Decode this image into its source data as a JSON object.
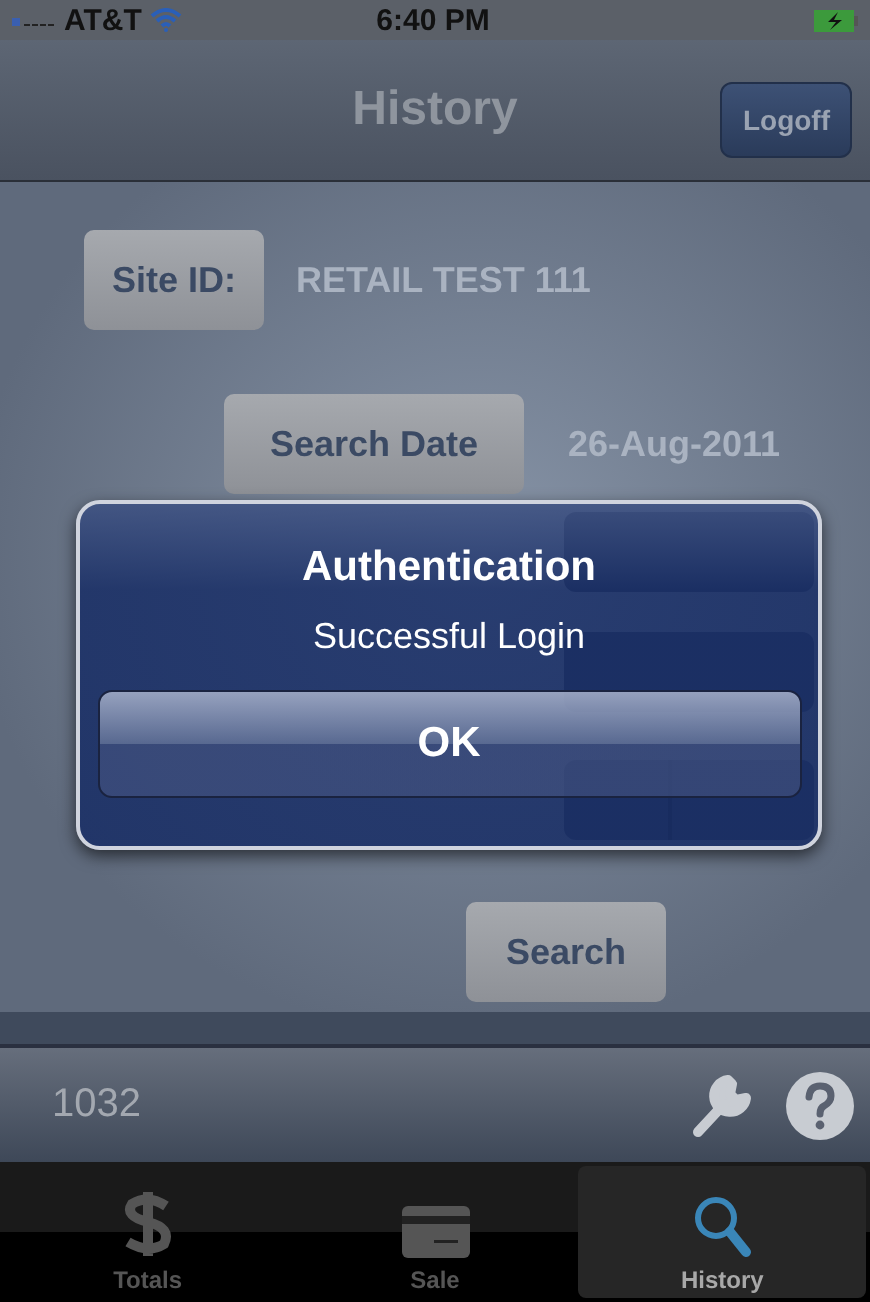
{
  "status_bar": {
    "carrier": "AT&T",
    "time": "6:40 PM"
  },
  "nav_bar": {
    "title": "History",
    "button": "Logoff"
  },
  "form": {
    "site_id_button": "Site ID:",
    "site_id_value": "RETAIL TEST 111",
    "search_date_button": "Search Date",
    "search_date_value": "26-Aug-2011",
    "search_button": "Search"
  },
  "bottom_bar": {
    "count": "1032"
  },
  "tabs": [
    {
      "label": "Totals",
      "selected": false
    },
    {
      "label": "Sale",
      "selected": false
    },
    {
      "label": "History",
      "selected": true
    }
  ],
  "alert": {
    "title": "Authentication",
    "message": "Successful Login",
    "button": "OK"
  }
}
